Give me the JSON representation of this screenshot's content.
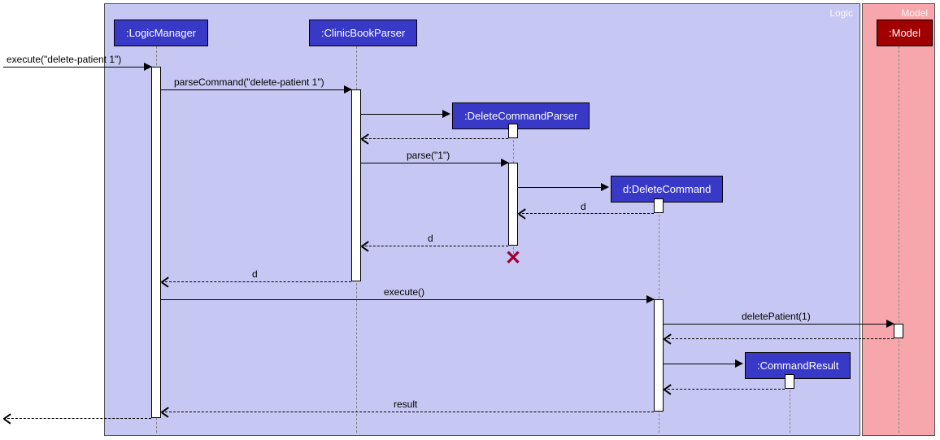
{
  "packages": {
    "logic": {
      "label": "Logic"
    },
    "model": {
      "label": "Model"
    }
  },
  "participants": {
    "logicManager": {
      "label": ":LogicManager"
    },
    "clinicBookParser": {
      "label": ":ClinicBookParser"
    },
    "deleteCommandParser": {
      "label": ":DeleteCommandParser"
    },
    "deleteCommand": {
      "label": "d:DeleteCommand"
    },
    "commandResult": {
      "label": ":CommandResult"
    },
    "model": {
      "label": ":Model"
    }
  },
  "messages": {
    "m1": {
      "label": "execute(\"delete-patient 1\")"
    },
    "m2": {
      "label": "parseCommand(\"delete-patient 1\")"
    },
    "m3": {
      "label": ""
    },
    "m4": {
      "label": ""
    },
    "m5": {
      "label": "parse(\"1\")"
    },
    "m6": {
      "label": ""
    },
    "m7": {
      "label": "d"
    },
    "m8": {
      "label": "d"
    },
    "m9": {
      "label": "d"
    },
    "m10": {
      "label": "execute()"
    },
    "m11": {
      "label": "deletePatient(1)"
    },
    "m12": {
      "label": ""
    },
    "m13": {
      "label": ""
    },
    "m14": {
      "label": ""
    },
    "m15": {
      "label": "result"
    },
    "m16": {
      "label": ""
    }
  }
}
